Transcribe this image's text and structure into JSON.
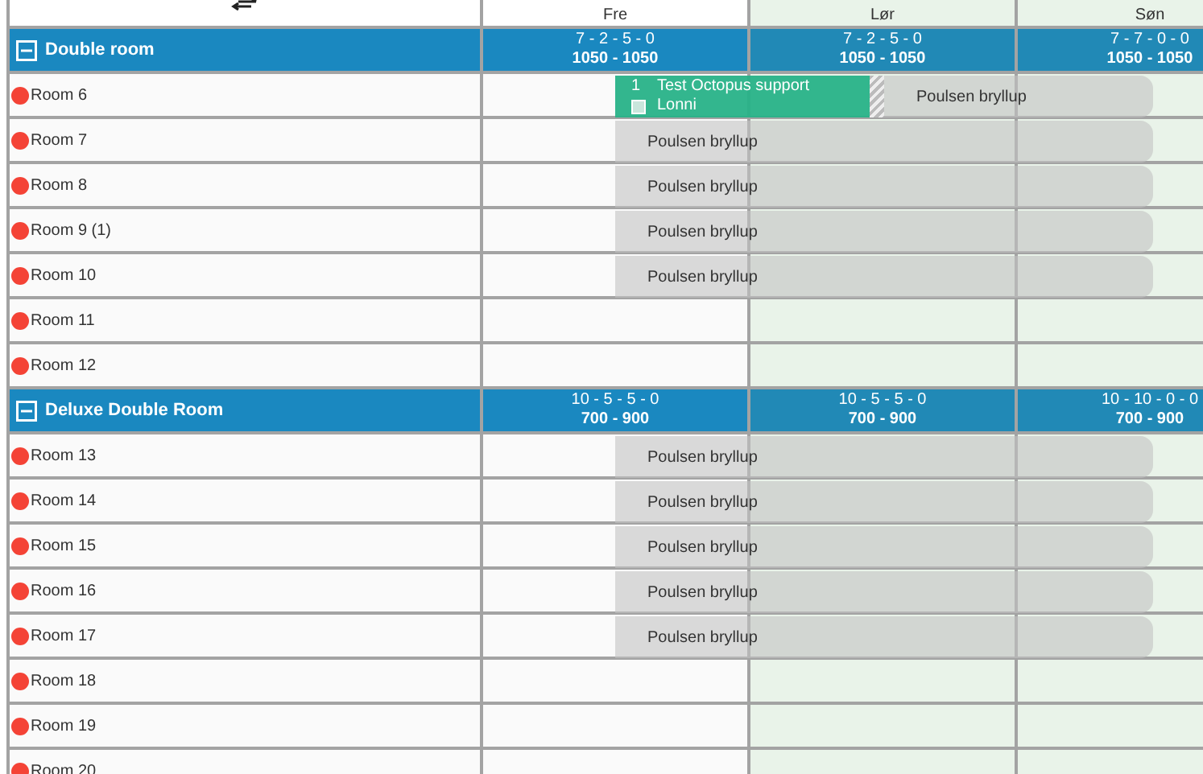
{
  "days": [
    {
      "label": "Fre",
      "weekend": false
    },
    {
      "label": "Lør",
      "weekend": true
    },
    {
      "label": "Søn",
      "weekend": true
    }
  ],
  "groups": [
    {
      "name": "Double room",
      "expanded": true,
      "day_stats": [
        [
          "7 - 2 - 5 - 0",
          "1050 - 1050"
        ],
        [
          "7 - 2 - 5 - 0",
          "1050 - 1050"
        ],
        [
          "7 - 7 - 0 - 0",
          "1050 - 1050"
        ]
      ],
      "rooms": [
        {
          "name": "Room 6",
          "color": "#f44336",
          "bookings": [
            {
              "kind": "confirmed",
              "number": "1",
              "title": "Test Octopus support",
              "guest": "Lonni"
            },
            {
              "kind": "tentative",
              "title": "Poulsen bryllup"
            }
          ]
        },
        {
          "name": "Room 7",
          "color": "#f44336",
          "bookings": [
            {
              "kind": "tentative",
              "title": "Poulsen bryllup"
            }
          ]
        },
        {
          "name": "Room 8",
          "color": "#f44336",
          "bookings": [
            {
              "kind": "tentative",
              "title": "Poulsen bryllup"
            }
          ]
        },
        {
          "name": "Room 9 (1)",
          "color": "#f44336",
          "bookings": [
            {
              "kind": "tentative",
              "title": "Poulsen bryllup"
            }
          ]
        },
        {
          "name": "Room 10",
          "color": "#f44336",
          "bookings": [
            {
              "kind": "tentative",
              "title": "Poulsen bryllup"
            }
          ]
        },
        {
          "name": "Room 11",
          "color": "#f44336"
        },
        {
          "name": "Room 12",
          "color": "#f44336"
        }
      ]
    },
    {
      "name": "Deluxe Double Room",
      "expanded": true,
      "day_stats": [
        [
          "10 - 5 - 5 - 0",
          "700 - 900"
        ],
        [
          "10 - 5 - 5 - 0",
          "700 - 900"
        ],
        [
          "10 - 10 - 0 - 0",
          "700 - 900"
        ]
      ],
      "rooms": [
        {
          "name": "Room 13",
          "color": "#f44336",
          "bookings": [
            {
              "kind": "tentative",
              "title": "Poulsen bryllup"
            }
          ]
        },
        {
          "name": "Room 14",
          "color": "#f44336",
          "bookings": [
            {
              "kind": "tentative",
              "title": "Poulsen bryllup"
            }
          ]
        },
        {
          "name": "Room 15",
          "color": "#f44336",
          "bookings": [
            {
              "kind": "tentative",
              "title": "Poulsen bryllup"
            }
          ]
        },
        {
          "name": "Room 16",
          "color": "#f44336",
          "bookings": [
            {
              "kind": "tentative",
              "title": "Poulsen bryllup"
            }
          ]
        },
        {
          "name": "Room 17",
          "color": "#f44336",
          "bookings": [
            {
              "kind": "tentative",
              "title": "Poulsen bryllup"
            }
          ]
        },
        {
          "name": "Room 18",
          "color": "#f44336"
        },
        {
          "name": "Room 19",
          "color": "#f44336"
        },
        {
          "name": "Room 20",
          "color": "#f44336"
        }
      ]
    }
  ]
}
